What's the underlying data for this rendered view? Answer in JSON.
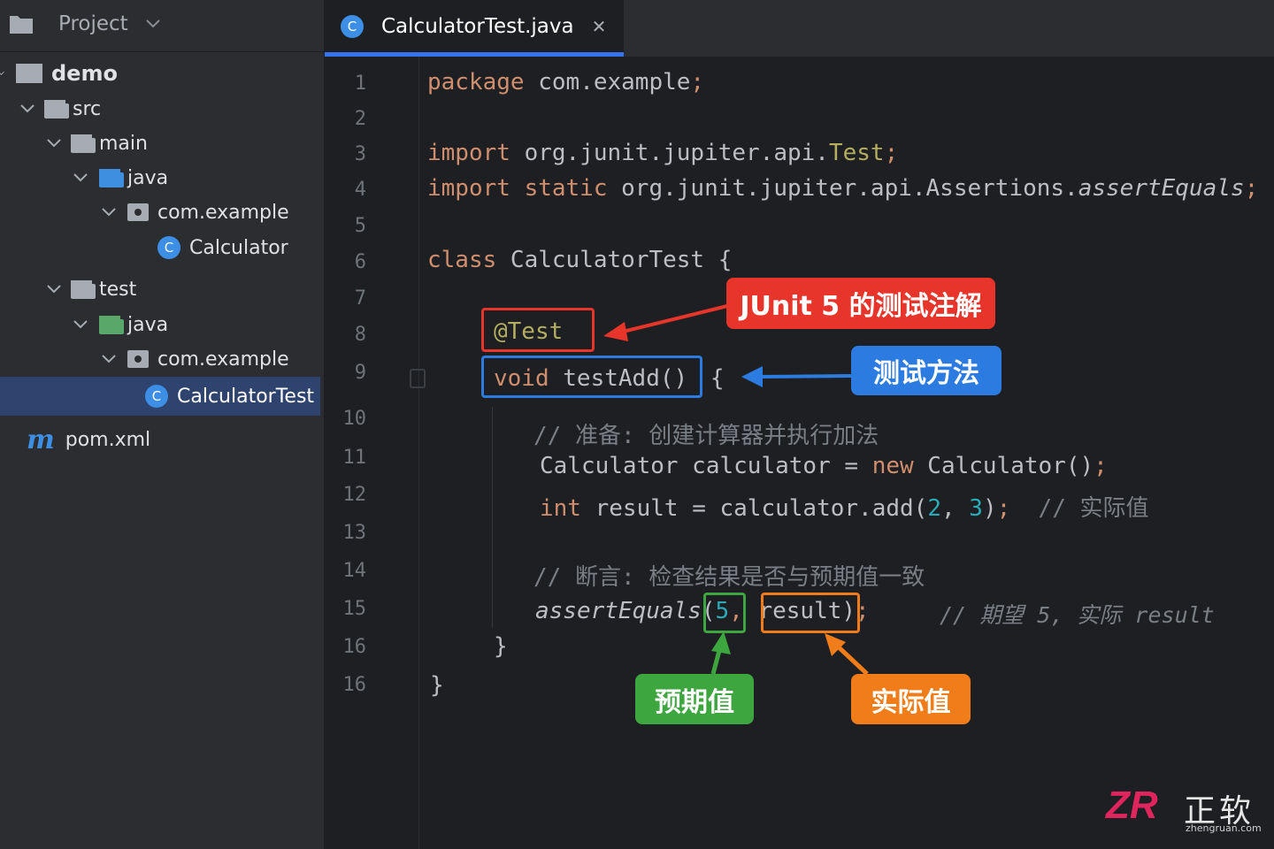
{
  "sidebar": {
    "title": "Project",
    "tree": [
      {
        "label": "demo",
        "icon": "folder-icon"
      },
      {
        "label": "src",
        "icon": "folder-icon"
      },
      {
        "label": "main",
        "icon": "folder-icon"
      },
      {
        "label": "java",
        "icon": "source-folder-icon"
      },
      {
        "label": "com.example",
        "icon": "package-icon"
      },
      {
        "label": "Calculator",
        "icon": "class-icon"
      },
      {
        "label": "test",
        "icon": "folder-icon"
      },
      {
        "label": "java",
        "icon": "test-source-folder-icon"
      },
      {
        "label": "com.example",
        "icon": "package-icon"
      },
      {
        "label": "CalculatorTest",
        "icon": "class-icon"
      },
      {
        "label": "pom.xml",
        "icon": "maven-icon"
      }
    ],
    "class_glyph": "C",
    "maven_glyph": "m"
  },
  "tab": {
    "title": "CalculatorTest.java",
    "icon_glyph": "C",
    "close_glyph": "✕"
  },
  "line_numbers": [
    "1",
    "2",
    "3",
    "4",
    "5",
    "6",
    "7",
    "8",
    "9",
    "10",
    "11",
    "12",
    "13",
    "14",
    "15",
    "16",
    "16"
  ],
  "code": {
    "l1_kw": "package",
    "l1_rest": " com.example",
    "l1_semi": ";",
    "l3_kw": "import",
    "l3_rest": " org.junit.jupiter.api.",
    "l3_cls": "Test",
    "l3_semi": ";",
    "l4_kw": "import static",
    "l4_rest": " org.junit.jupiter.api.Assertions.",
    "l4_fn": "assertEquals",
    "l4_semi": ";",
    "l6_kw": "class",
    "l6_rest": " CalculatorTest {",
    "l8_annotation": "@Test",
    "l9_kw": "void",
    "l9_rest": " testAdd()",
    "l9_brace": " {",
    "l10_comment": "// 准备: 创建计算器并执行加法",
    "l11_a": "Calculator calculator = ",
    "l11_kw": "new",
    "l11_b": " Calculator()",
    "l11_semi": ";",
    "l12_kw": "int",
    "l12_a": " result = calculator.add(",
    "l12_n1": "2",
    "l12_c": ", ",
    "l12_n2": "3",
    "l12_d": ")",
    "l12_semi": ";",
    "l12_comment": "  // 实际值",
    "l14_comment": "// 断言: 检查结果是否与预期值一致",
    "l15_fn": "assertEquals",
    "l15_p": "(",
    "l15_n": "5",
    "l15_comma": ",",
    "l15_res": " result",
    "l15_close": ")",
    "l15_semi": ";",
    "l15_comment": "// 期望 5, 实际 result",
    "l16_brace": "}",
    "l17_brace": "}"
  },
  "annotations": {
    "junit_annotation": "JUnit 5 的测试注解",
    "test_method": "测试方法",
    "expected_value": "预期值",
    "actual_value": "实际值"
  },
  "colors": {
    "red": "#e8352b",
    "blue": "#2b7be0",
    "green": "#3ea63f",
    "orange": "#f07d1a"
  },
  "watermark": {
    "logo": "ZR",
    "name": "正软",
    "site": "zhengruan.com"
  }
}
